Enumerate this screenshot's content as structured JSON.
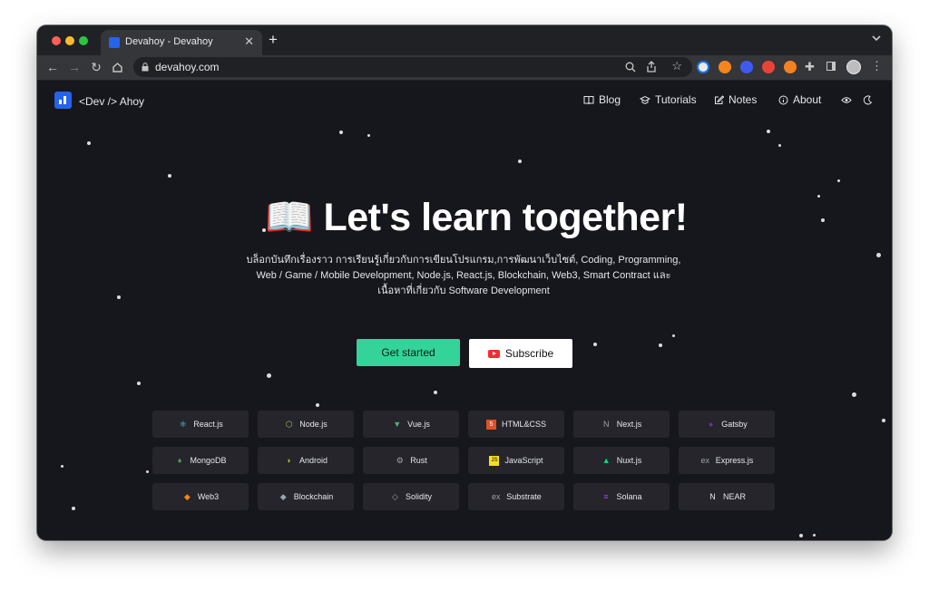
{
  "browser": {
    "tab_title": "Devahoy - Devahoy",
    "url": "devahoy.com"
  },
  "site": {
    "logo_text": "<Dev /> Ahoy",
    "nav": [
      {
        "label": "Blog",
        "icon": "book-icon"
      },
      {
        "label": "Tutorials",
        "icon": "graduation-cap-icon"
      },
      {
        "label": "Notes",
        "icon": "pencil-square-icon"
      },
      {
        "label": "About",
        "icon": "info-circle-icon"
      }
    ]
  },
  "hero": {
    "emoji": "📖",
    "title": "Let's learn together!",
    "line1": "บล็อกบันทึกเรื่องราว การเรียนรู้เกี่ยวกับการเขียนโปรแกรม,การพัฒนาเว็บไซต์, Coding, Programming,",
    "line2": "Web / Game / Mobile Development, Node.js, React.js, Blockchain, Web3, Smart Contract และ",
    "line3": "เนื้อหาที่เกี่ยวกับ Software Development"
  },
  "buttons": {
    "get_started": "Get started",
    "subscribe": "Subscribe"
  },
  "technologies": [
    {
      "label": "React.js",
      "icon": "react-icon",
      "color": "#61dafb"
    },
    {
      "label": "Node.js",
      "icon": "nodejs-icon",
      "color": "#8cc84b"
    },
    {
      "label": "Vue.js",
      "icon": "vue-icon",
      "color": "#42b883"
    },
    {
      "label": "HTML&CSS",
      "icon": "html5-icon",
      "color": "#e34f26"
    },
    {
      "label": "Next.js",
      "icon": "nextjs-icon",
      "color": "#9ca3af"
    },
    {
      "label": "Gatsby",
      "icon": "gatsby-icon",
      "color": "#663399"
    },
    {
      "label": "MongoDB",
      "icon": "mongodb-icon",
      "color": "#47a248"
    },
    {
      "label": "Android",
      "icon": "android-icon",
      "color": "#a4c639"
    },
    {
      "label": "Rust",
      "icon": "rust-icon",
      "color": "#9ca3af"
    },
    {
      "label": "JavaScript",
      "icon": "javascript-icon",
      "color": "#f7df1e"
    },
    {
      "label": "Nuxt.js",
      "icon": "nuxt-icon",
      "color": "#00dc82"
    },
    {
      "label": "Express.js",
      "icon": "express-icon",
      "color": "#9ca3af"
    },
    {
      "label": "Web3",
      "icon": "metamask-icon",
      "color": "#f6851b"
    },
    {
      "label": "Blockchain",
      "icon": "ethereum-icon",
      "color": "#9ca3af"
    },
    {
      "label": "Solidity",
      "icon": "solidity-icon",
      "color": "#9ca3af"
    },
    {
      "label": "Substrate",
      "icon": "substrate-icon",
      "color": "#9ca3af"
    },
    {
      "label": "Solana",
      "icon": "solana-icon",
      "color": "#9945ff"
    },
    {
      "label": "NEAR",
      "icon": "near-icon",
      "color": "#e5e7eb"
    }
  ]
}
